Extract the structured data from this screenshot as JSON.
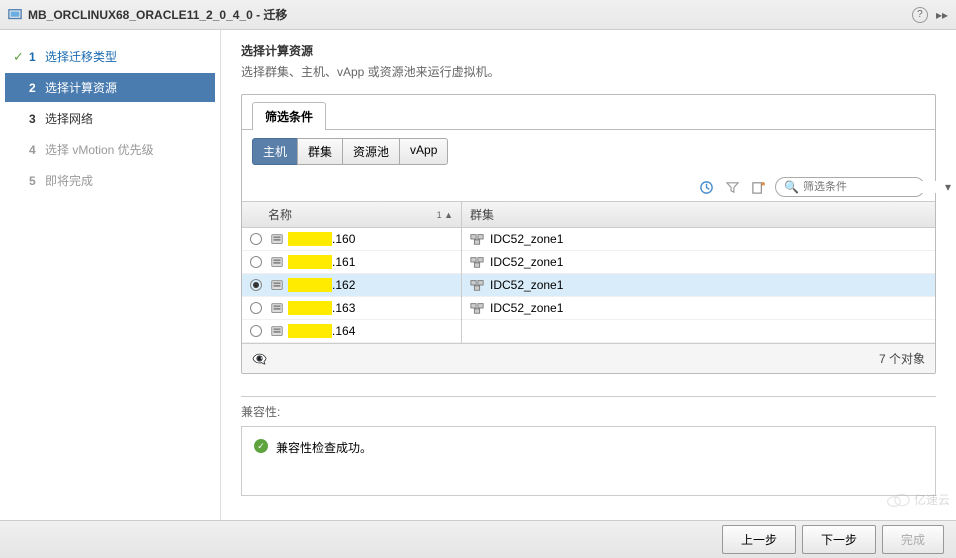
{
  "titlebar": {
    "title": "MB_ORCLINUX68_ORACLE11_2_0_4_0 - 迁移"
  },
  "sidebar": {
    "steps": [
      {
        "num": "1",
        "label": "选择迁移类型",
        "state": "done"
      },
      {
        "num": "2",
        "label": "选择计算资源",
        "state": "active"
      },
      {
        "num": "3",
        "label": "选择网络",
        "state": "pending"
      },
      {
        "num": "4",
        "label": "选择 vMotion 优先级",
        "state": "disabled"
      },
      {
        "num": "5",
        "label": "即将完成",
        "state": "disabled"
      }
    ]
  },
  "content": {
    "title": "选择计算资源",
    "desc": "选择群集、主机、vApp 或资源池来运行虚拟机。",
    "filter_tab": "筛选条件",
    "inner_tabs": [
      "主机",
      "群集",
      "资源池",
      "vApp"
    ],
    "active_tab": 0,
    "search_placeholder": "筛选条件",
    "columns": {
      "name": "名称",
      "sort": "1 ▲",
      "cluster": "群集"
    },
    "rows": [
      {
        "host": ".160",
        "cluster": "IDC52_zone1",
        "selected": false
      },
      {
        "host": ".161",
        "cluster": "IDC52_zone1",
        "selected": false
      },
      {
        "host": ".162",
        "cluster": "IDC52_zone1",
        "selected": true
      },
      {
        "host": ".163",
        "cluster": "IDC52_zone1",
        "selected": false
      },
      {
        "host": ".164",
        "cluster": "",
        "selected": false
      }
    ],
    "object_count": "7 个对象",
    "compat_label": "兼容性:",
    "compat_msg": "兼容性检查成功。"
  },
  "footer": {
    "back": "上一步",
    "next": "下一步",
    "finish": "完成"
  },
  "watermark": "亿速云"
}
